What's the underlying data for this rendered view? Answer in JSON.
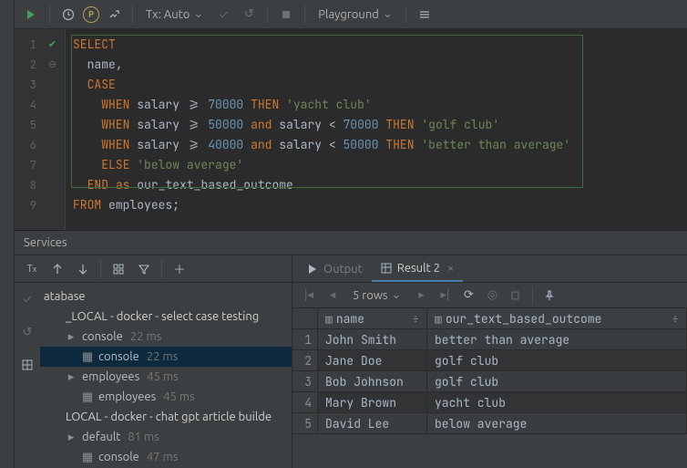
{
  "toolbar": {
    "tx_label": "Tx: Auto",
    "playground_label": "Playground",
    "p_badge": "P"
  },
  "code": {
    "lines": [
      {
        "n": 1,
        "html": "<span class='kw'>SELECT</span>"
      },
      {
        "n": 2,
        "html": "  <span class='ident'>name</span>,"
      },
      {
        "n": 3,
        "html": "  <span class='kw'>CASE</span>"
      },
      {
        "n": 4,
        "html": "    <span class='kw'>WHEN</span> <span class='ident'>salary</span> >= <span class='num'>70000</span> <span class='kw'>THEN</span> <span class='str'>'yacht club'</span>"
      },
      {
        "n": 5,
        "html": "    <span class='kw'>WHEN</span> <span class='ident'>salary</span> >= <span class='num'>50000</span> <span class='kw'>and</span> <span class='ident'>salary</span> < <span class='num'>70000</span> <span class='kw'>THEN</span> <span class='str'>'golf club'</span>"
      },
      {
        "n": 6,
        "html": "    <span class='kw'>WHEN</span> <span class='ident'>salary</span> >= <span class='num'>40000</span> <span class='kw'>and</span> <span class='ident'>salary</span> < <span class='num'>50000</span> <span class='kw'>THEN</span> <span class='str'>'better than average'</span>"
      },
      {
        "n": 7,
        "html": "    <span class='kw'>ELSE</span> <span class='str'>'below average'</span>"
      },
      {
        "n": 8,
        "html": "  <span class='kw'>END</span> <span class='kw'>as</span> <span class='ident'>our_text_based_outcome</span>"
      },
      {
        "n": 9,
        "html": "<span class='kw'>FROM</span> <span class='ident'>employees</span>;"
      }
    ]
  },
  "services": {
    "title": "Services",
    "tree_heading": "atabase",
    "tree": [
      {
        "indent": 0,
        "label": "_LOCAL - docker - select case testing",
        "ms": ""
      },
      {
        "indent": 1,
        "label": "console",
        "ms": "22 ms"
      },
      {
        "indent": 2,
        "label": "console",
        "ms": "22 ms",
        "selected": true
      },
      {
        "indent": 1,
        "label": "employees",
        "ms": "45 ms"
      },
      {
        "indent": 2,
        "label": "employees",
        "ms": "45 ms"
      },
      {
        "indent": 0,
        "label": "LOCAL - docker - chat gpt article builde"
      },
      {
        "indent": 1,
        "label": "default",
        "ms": "81 ms"
      },
      {
        "indent": 2,
        "label": "console",
        "ms": "47 ms"
      }
    ],
    "tabs": {
      "output": "Output",
      "result": "Result 2"
    },
    "rows_label": "5 rows",
    "columns": [
      "name",
      "our_text_based_outcome"
    ],
    "data": [
      [
        "John Smith",
        "better than average"
      ],
      [
        "Jane Doe",
        "golf club"
      ],
      [
        "Bob Johnson",
        "golf club"
      ],
      [
        "Mary Brown",
        "yacht club"
      ],
      [
        "David Lee",
        "below average"
      ]
    ]
  }
}
